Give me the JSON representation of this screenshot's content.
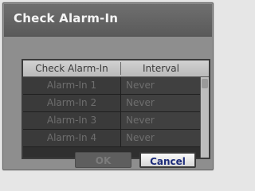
{
  "dialog": {
    "title": "Check Alarm-In"
  },
  "table": {
    "columns": [
      "Check Alarm-In",
      "Interval"
    ],
    "rows": [
      {
        "name": "Alarm-In 1",
        "interval": "Never"
      },
      {
        "name": "Alarm-In 2",
        "interval": "Never"
      },
      {
        "name": "Alarm-In 3",
        "interval": "Never"
      },
      {
        "name": "Alarm-In 4",
        "interval": "Never"
      }
    ]
  },
  "buttons": {
    "ok": "OK",
    "cancel": "Cancel"
  }
}
